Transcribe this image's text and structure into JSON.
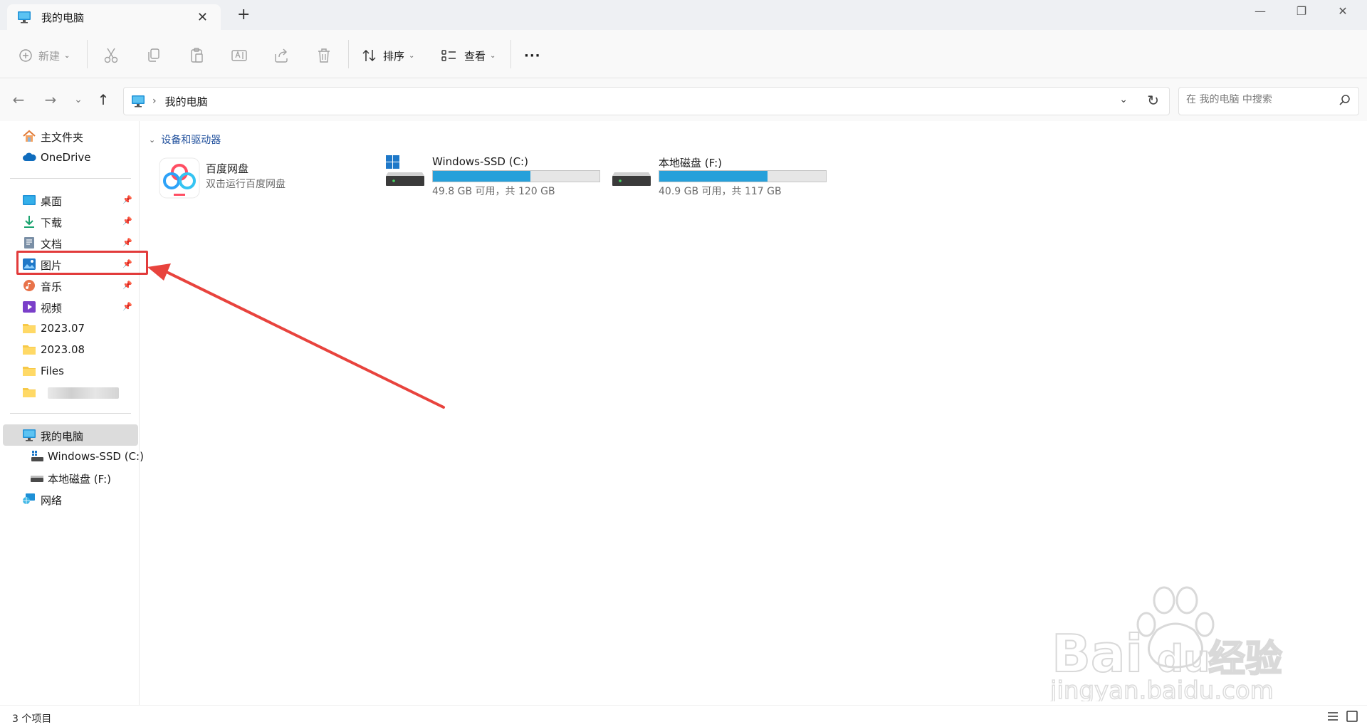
{
  "window": {
    "tab_title": "我的电脑",
    "new_tab": "+",
    "close_tab": "✕",
    "minimize": "—",
    "maximize": "❐",
    "close": "✕"
  },
  "toolbar": {
    "new_label": "新建",
    "sort_label": "排序",
    "view_label": "查看",
    "more_label": "···",
    "icons": [
      "cut-icon",
      "copy-icon",
      "paste-icon",
      "rename-icon",
      "share-icon",
      "delete-icon"
    ]
  },
  "address": {
    "crumb": "我的电脑",
    "search_placeholder": "在 我的电脑 中搜索"
  },
  "sidebar": {
    "home": "主文件夹",
    "onedrive": "OneDrive",
    "quick_access": [
      {
        "label": "桌面",
        "pinned": true
      },
      {
        "label": "下载",
        "pinned": true
      },
      {
        "label": "文档",
        "pinned": true
      },
      {
        "label": "图片",
        "pinned": true
      },
      {
        "label": "音乐",
        "pinned": true
      },
      {
        "label": "视频",
        "pinned": true
      },
      {
        "label": "2023.07",
        "pinned": false
      },
      {
        "label": "2023.08",
        "pinned": false
      },
      {
        "label": "Files",
        "pinned": false
      },
      {
        "label": "",
        "pinned": false
      }
    ],
    "this_pc": "我的电脑",
    "drives": [
      "Windows-SSD (C:)",
      "本地磁盘 (F:)"
    ],
    "network": "网络"
  },
  "content": {
    "group_title": "设备和驱动器",
    "items": [
      {
        "name": "百度网盘",
        "sub": "双击运行百度网盘"
      },
      {
        "name": "Windows-SSD (C:)",
        "sub": "49.8 GB 可用，共 120 GB",
        "used_fraction": 0.585
      },
      {
        "name": "本地磁盘 (F:)",
        "sub": "40.9 GB 可用，共 117 GB",
        "used_fraction": 0.65
      }
    ]
  },
  "status": {
    "item_count": "3 个项目"
  },
  "colors": {
    "accent": "#26a0da",
    "highlight": "#e23b3b"
  }
}
